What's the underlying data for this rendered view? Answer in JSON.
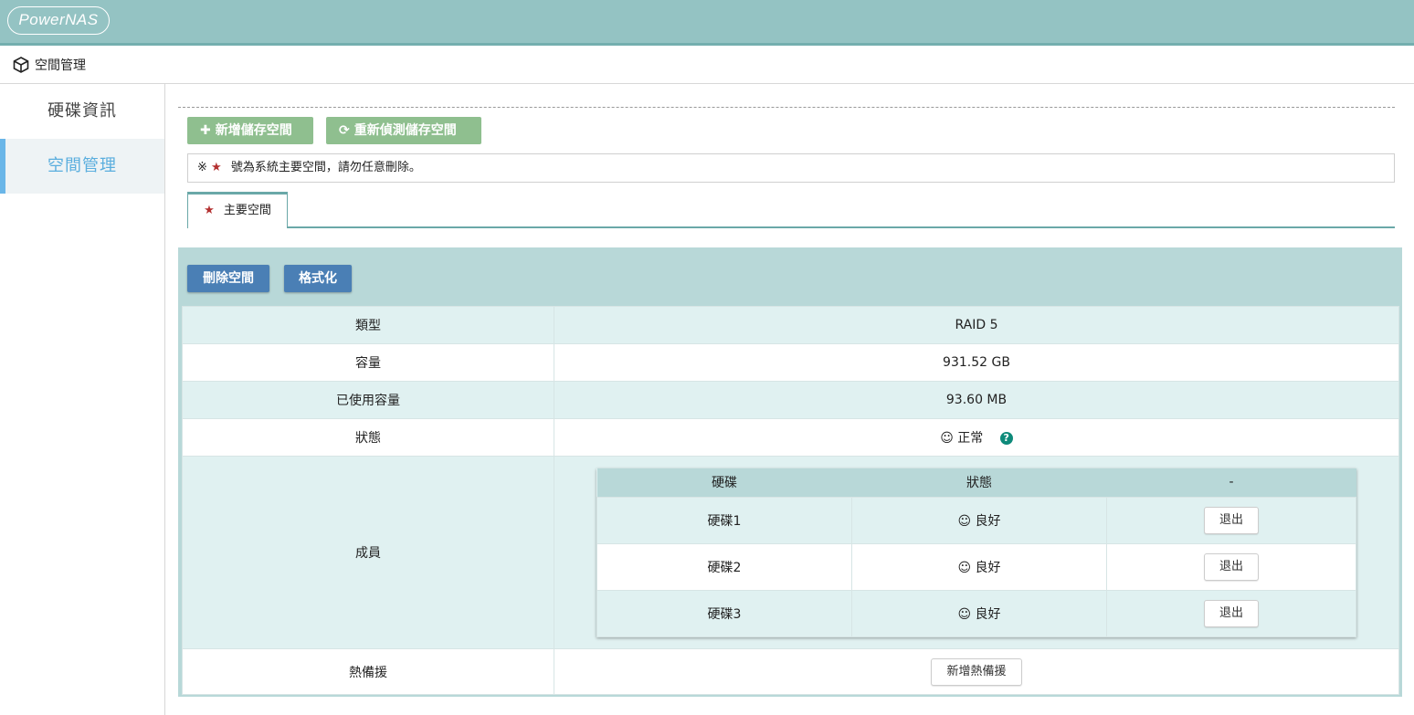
{
  "header": {
    "logo_text": "PowerNAS"
  },
  "breadcrumb": {
    "label": "空間管理"
  },
  "sidebar": {
    "items": [
      {
        "label": "硬碟資訊",
        "active": false
      },
      {
        "label": "空間管理",
        "active": true
      }
    ]
  },
  "toolbar": {
    "add_label": "新增儲存空間",
    "rescan_label": "重新偵測儲存空間"
  },
  "notice": {
    "prefix": "※",
    "text": "號為系統主要空間，請勿任意刪除。"
  },
  "tabs": [
    {
      "label": "主要空間",
      "active": true
    }
  ],
  "panel": {
    "delete_label": "刪除空間",
    "format_label": "格式化",
    "rows": {
      "type_key": "類型",
      "type_val": "RAID 5",
      "capacity_key": "容量",
      "capacity_val": "931.52 GB",
      "used_key": "已使用容量",
      "used_val": "93.60 MB",
      "status_key": "狀態",
      "status_val": "正常",
      "members_key": "成員",
      "spare_key": "熱備援",
      "spare_button": "新增熱備援"
    },
    "members": {
      "headers": [
        "硬碟",
        "狀態",
        "-"
      ],
      "rows": [
        {
          "disk": "硬碟1",
          "status": "良好",
          "action": "退出"
        },
        {
          "disk": "硬碟2",
          "status": "良好",
          "action": "退出"
        },
        {
          "disk": "硬碟3",
          "status": "良好",
          "action": "退出"
        }
      ]
    }
  },
  "colors": {
    "header_bg": "#94c3c3",
    "green_button": "#8fbf8f",
    "blue_button": "#4a7fb5",
    "sidebar_active": "#5aaede",
    "status_good": "#2a8a4a"
  }
}
